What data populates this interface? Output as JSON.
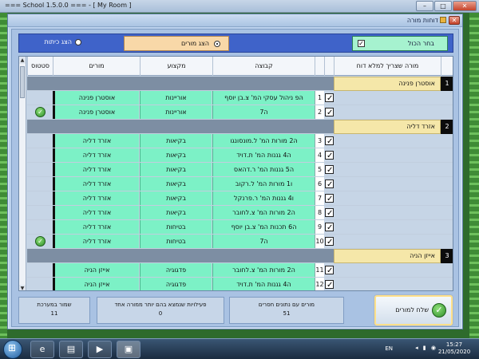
{
  "app": {
    "title": "=== School 1.5.0.0 ===    - [ My Room ]"
  },
  "dialog": {
    "title": "דוחות מורה",
    "close": "✕"
  },
  "filter": {
    "select_all_label": "בחר הכול",
    "show_teachers_label": "הצג מורים",
    "show_classes_label": "הצג כיתות"
  },
  "columns": {
    "teacher_to_fill": "מורה שצריך למלא דוח",
    "group": "קבוצה",
    "subject": "מקצוע",
    "teachers": "מורים",
    "status": "סטטוס"
  },
  "sections": [
    {
      "index": "1",
      "name": "אוסטרן פנינה",
      "rows": [
        {
          "num": "1",
          "group": "הּפ ניהול עסקי המ' צ.בן יוסף",
          "subject": "אוריינות",
          "teacher": "אוסטרן פנינה",
          "status_ok": false
        },
        {
          "num": "2",
          "group": "ה7",
          "subject": "אוריינות",
          "teacher": "אוסטרן פנינה",
          "status_ok": true
        }
      ]
    },
    {
      "index": "2",
      "name": "אזרד דליה",
      "rows": [
        {
          "num": "3",
          "group": "הּ2 מורות המ' ל.מונסונגו",
          "subject": "בקיאות",
          "teacher": "אזרד דליה",
          "status_ok": false
        },
        {
          "num": "4",
          "group": "ה4 גננות המ' ת.דויד",
          "subject": "בקיאות",
          "teacher": "אזרד דליה",
          "status_ok": false
        },
        {
          "num": "5",
          "group": "ה5 גננות המ' ר.דהאס",
          "subject": "בקיאות",
          "teacher": "אזרד דליה",
          "status_ok": false
        },
        {
          "num": "6",
          "group": "ו1 מורות המ' ל.רקוב",
          "subject": "בקיאות",
          "teacher": "אזרד דליה",
          "status_ok": false
        },
        {
          "num": "7",
          "group": "ו4 גננות המ' ר.פרנקל",
          "subject": "בקיאות",
          "teacher": "אזרד דליה",
          "status_ok": false
        },
        {
          "num": "8",
          "group": "ה2 מורות המ' צ.לחובר",
          "subject": "בקיאות",
          "teacher": "אזרד דליה",
          "status_ok": false
        },
        {
          "num": "9",
          "group": "ה6 תכנות המ' צ.בן יוסף",
          "subject": "בטיחות",
          "teacher": "אזרד דליה",
          "status_ok": false
        },
        {
          "num": "10",
          "group": "ה7",
          "subject": "בטיחות",
          "teacher": "אזרד דליה",
          "status_ok": true
        }
      ]
    },
    {
      "index": "3",
      "name": "אייזן הניה",
      "rows": [
        {
          "num": "11",
          "group": "ה2 מורות המ' צ.לחובר",
          "subject": "פדגוגיה",
          "teacher": "אייזן הניה",
          "status_ok": false
        },
        {
          "num": "12",
          "group": "ה4 גננות המ' ת.דויד",
          "subject": "פדגוגיה",
          "teacher": "אייזן הניה",
          "status_ok": false
        }
      ]
    }
  ],
  "stats": {
    "saved_label": "שמור במערכת",
    "saved_value": "11",
    "multi_label": "פעילויות שנמצא בהם יותר ממורה אחד",
    "multi_value": "0",
    "missing_label": "מורים עם נתונים חסרים",
    "missing_value": "51"
  },
  "send_button": {
    "label": "שלח למורים"
  },
  "taskbar": {
    "lang": "EN",
    "time": "15:27",
    "date": "21/05/2020"
  },
  "colors": {
    "row_green": "#7cf1c6",
    "section_yellow": "#f5e7a9",
    "filter_blue": "#3f63c9"
  }
}
